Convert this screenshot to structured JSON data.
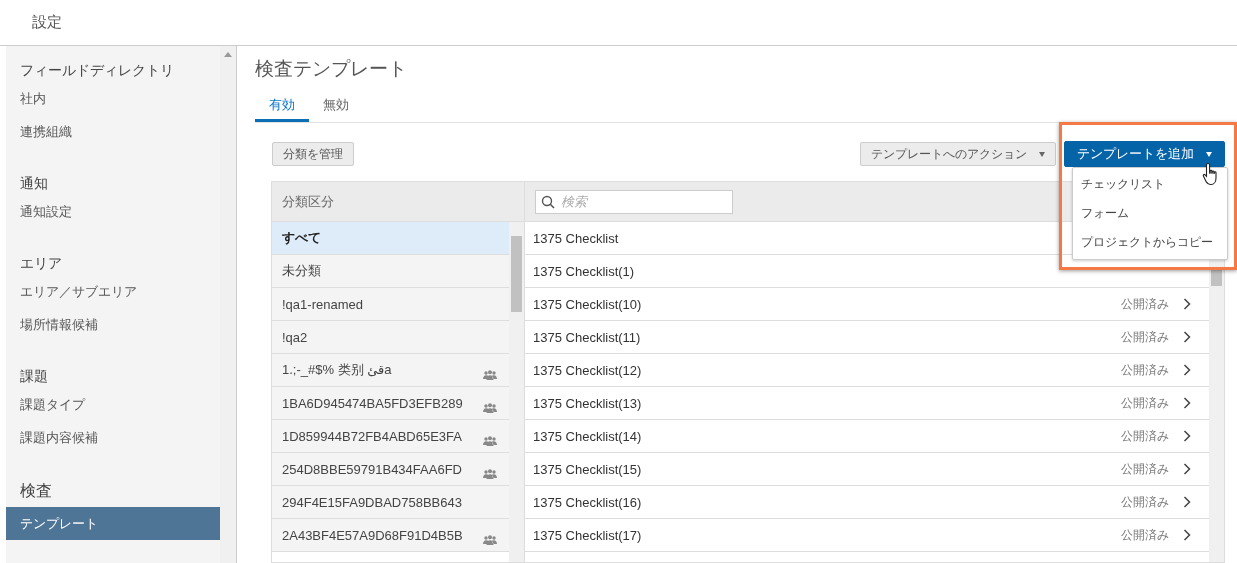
{
  "header": {
    "title": "設定"
  },
  "sidebar": {
    "sections": [
      {
        "title": "フィールドディレクトリ",
        "items": [
          {
            "label": "社内",
            "selected": false
          },
          {
            "label": "連携組織",
            "selected": false
          }
        ]
      },
      {
        "title": "通知",
        "items": [
          {
            "label": "通知設定",
            "selected": false
          }
        ]
      },
      {
        "title": "エリア",
        "items": [
          {
            "label": "エリア／サブエリア",
            "selected": false
          },
          {
            "label": "場所情報候補",
            "selected": false
          }
        ]
      },
      {
        "title": "課題",
        "items": [
          {
            "label": "課題タイプ",
            "selected": false
          },
          {
            "label": "課題内容候補",
            "selected": false
          }
        ]
      },
      {
        "title": "検査",
        "items": [
          {
            "label": "テンプレート",
            "selected": true
          }
        ]
      }
    ]
  },
  "page_title": "検査テンプレート",
  "tabs": [
    {
      "label": "有効",
      "selected": true
    },
    {
      "label": "無効",
      "selected": false
    }
  ],
  "manage_button": "分類を管理",
  "actions_button": "テンプレートへのアクション",
  "add_button": "テンプレートを追加",
  "add_menu": [
    "チェックリスト",
    "フォーム",
    "プロジェクトからコピー"
  ],
  "categories": {
    "header": "分類区分",
    "items": [
      {
        "label": "すべて",
        "selected": true,
        "shared": false
      },
      {
        "label": "未分類",
        "selected": false,
        "shared": false
      },
      {
        "label": "!qa1-renamed",
        "selected": false,
        "shared": false
      },
      {
        "label": "!qa2",
        "selected": false,
        "shared": false
      },
      {
        "label": "1.;-_#$% 类别 قئa",
        "selected": false,
        "shared": true
      },
      {
        "label": "1BA6D945474BA5FD3EFB289",
        "selected": false,
        "shared": true
      },
      {
        "label": "1D859944B72FB4ABD65E3FA",
        "selected": false,
        "shared": true
      },
      {
        "label": "254D8BBE59791B434FAA6FD",
        "selected": false,
        "shared": true
      },
      {
        "label": "294F4E15FA9DBAD758BB643",
        "selected": false,
        "shared": false
      },
      {
        "label": "2A43BF4E57A9D68F91D4B5B",
        "selected": false,
        "shared": true
      }
    ]
  },
  "templates": {
    "search_placeholder": "検索",
    "rows": [
      {
        "name": "1375 Checklist"
      },
      {
        "name": "1375 Checklist(1)"
      },
      {
        "name": "1375 Checklist(10)",
        "status": "公開済み"
      },
      {
        "name": "1375 Checklist(11)",
        "status": "公開済み"
      },
      {
        "name": "1375 Checklist(12)",
        "status": "公開済み"
      },
      {
        "name": "1375 Checklist(13)",
        "status": "公開済み"
      },
      {
        "name": "1375 Checklist(14)",
        "status": "公開済み"
      },
      {
        "name": "1375 Checklist(15)",
        "status": "公開済み"
      },
      {
        "name": "1375 Checklist(16)",
        "status": "公開済み"
      },
      {
        "name": "1375 Checklist(17)",
        "status": "公開済み"
      }
    ]
  }
}
